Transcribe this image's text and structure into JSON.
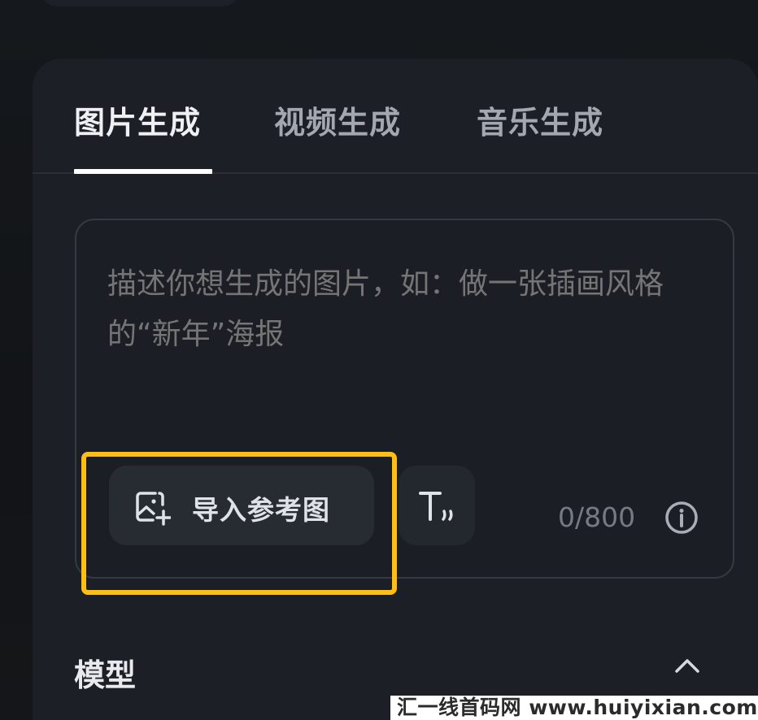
{
  "tabs": [
    {
      "label": "图片生成",
      "active": true
    },
    {
      "label": "视频生成",
      "active": false
    },
    {
      "label": "音乐生成",
      "active": false
    }
  ],
  "prompt": {
    "placeholder": "描述你想生成的图片，如：做一张插画风格的“新年”海报",
    "char_count": "0/800"
  },
  "toolbar": {
    "import_label": "导入参考图",
    "import_icon": "image-add-icon",
    "text_icon": "text-style-icon",
    "info_icon": "info-icon"
  },
  "model_section": {
    "title": "模型",
    "expanded": true,
    "toggle_icon": "chevron-up-icon"
  },
  "watermark": {
    "text": "汇一线首码网 www.huiyixian.com"
  },
  "colors": {
    "highlight": "#ffbe12",
    "panel": "#1c2026",
    "active_tab": "#eef0f3"
  }
}
